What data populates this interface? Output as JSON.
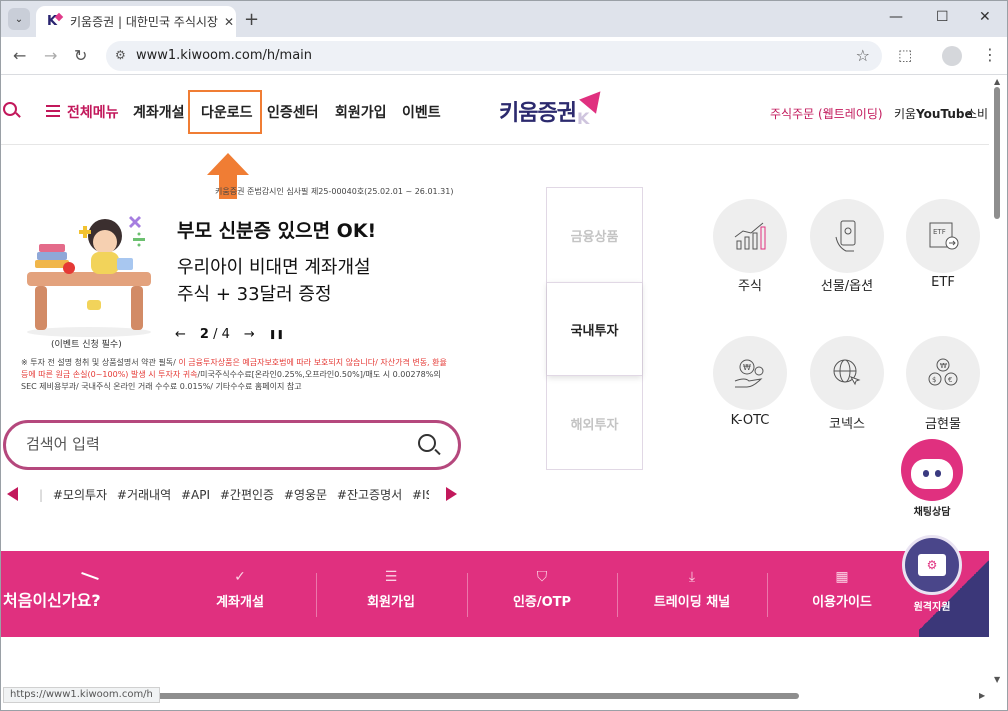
{
  "browser": {
    "tab_title": "키움증권 | 대한민국 주식시장",
    "tab_close": "✕",
    "new_tab": "+",
    "url": "www1.kiwoom.com/h/main",
    "status_url": "https://www1.kiwoom.com/h",
    "icons": [
      "tab-search-icon",
      "favicon-icon",
      "close-icon",
      "plus-icon",
      "minimize-icon",
      "maximize-icon",
      "close-window-icon",
      "back-icon",
      "forward-icon",
      "reload-icon",
      "site-info-icon",
      "star-icon",
      "extensions-icon",
      "profile-icon",
      "more-icon"
    ]
  },
  "gnb": {
    "all_menu": "전체메뉴",
    "items": [
      "계좌개설",
      "다운로드",
      "인증센터",
      "회원가입",
      "이벤트"
    ],
    "logo_text": "키움증권",
    "logo_k": "K",
    "right": {
      "web_trading": "주식주문 (웹트레이딩)",
      "youtube_prefix": "키움",
      "youtube": "YouTube",
      "extra": "소비"
    },
    "highlight_color": "#f07d34"
  },
  "hero": {
    "notice": "키움증권 준법감시인 심사필 제25-00040호(25.02.01 ~ 26.01.31)",
    "title": "부모 신분증 있으면 OK!",
    "sub1": "우리아이 비대면 계좌개설",
    "sub2": "주식 + 33달러 증정",
    "caption": "(이벤트 신청 필수)",
    "page_current": "2",
    "page_total": "/ 4",
    "prev": "←",
    "next": "→",
    "pause": "❚❚",
    "disclaimer_1": "※ 투자 전 설명 청취 및 상품설명서 약관 필독/ ",
    "disclaimer_red": "이 금융투자상품은 예금자보호법에 따라 보호되지 않습니다/ 자산가격 변동, 환율 등에 따른 원금 손실(0~100%) 발생 시 투자자 귀속",
    "disclaimer_2": "/미국주식수수료[온라인0.25%,오프라인0.50%]/매도 시 0.00278%의 SEC 제비용부과/ 국내주식 온라인 거래 수수료 0.015%/ 기타수수료 홈페이지 참고"
  },
  "search": {
    "placeholder": "검색어 입력",
    "tags": [
      "#모의투자",
      "#거래내역",
      "#API",
      "#간편인증",
      "#영웅문",
      "#잔고증명서",
      "#IS/"
    ]
  },
  "product_tabs": [
    "금융상품",
    "국내투자",
    "해외투자"
  ],
  "product_icons": [
    {
      "label": "주식",
      "icon": "stock-chart-icon"
    },
    {
      "label": "선물/옵션",
      "icon": "mobile-hand-icon"
    },
    {
      "label": "ETF",
      "icon": "etf-doc-icon"
    },
    {
      "label": "K-OTC",
      "icon": "won-hand-icon"
    },
    {
      "label": "코넥스",
      "icon": "globe-cursor-icon"
    },
    {
      "label": "금현물",
      "icon": "coins-icon"
    }
  ],
  "chatbot": {
    "label": "채팅상담"
  },
  "band": {
    "title": "처음이신가요?",
    "items": [
      {
        "label": "계좌개설",
        "icon": "✓"
      },
      {
        "label": "회원가입",
        "icon": "☰"
      },
      {
        "label": "인증/OTP",
        "icon": "⛉"
      },
      {
        "label": "트레이딩 채널",
        "icon": "⤓"
      },
      {
        "label": "이용가이드",
        "icon": "▦"
      }
    ],
    "color": "#e0307f"
  },
  "remote": {
    "label": "원격지원",
    "glyph": "⚙"
  }
}
